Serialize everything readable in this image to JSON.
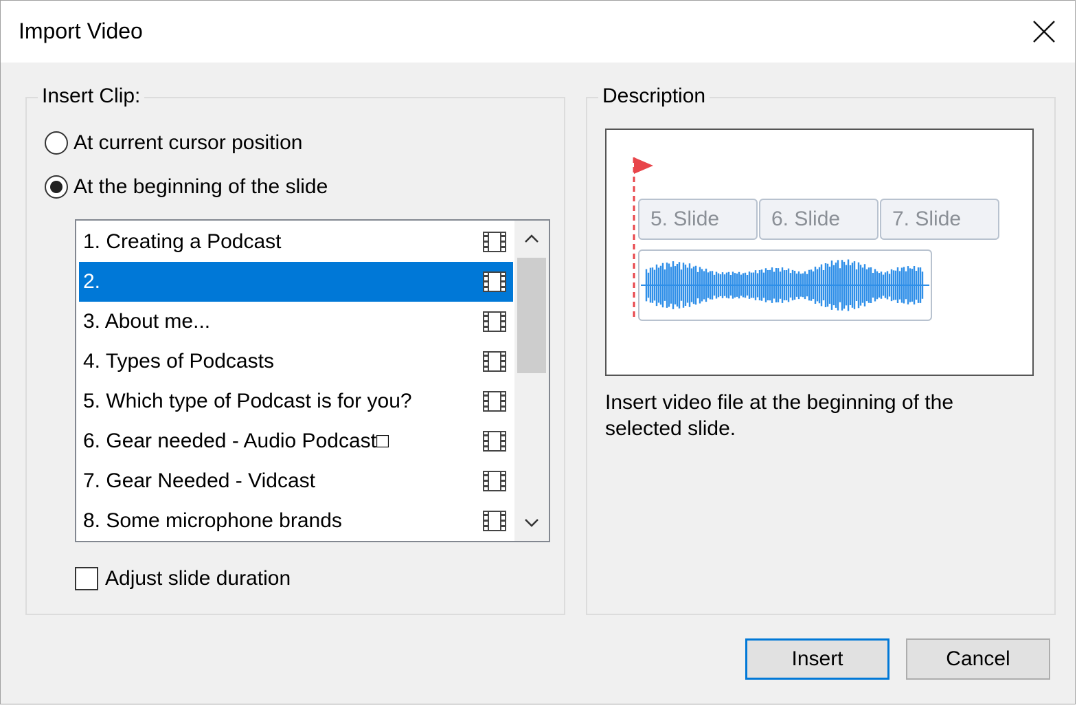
{
  "dialog": {
    "title": "Import Video",
    "close_icon": "close-icon"
  },
  "insert_clip": {
    "legend": "Insert Clip:",
    "options": [
      {
        "label": "At current cursor position",
        "selected": false
      },
      {
        "label": "At the beginning of the slide",
        "selected": true
      }
    ],
    "slides": [
      {
        "label": "1. Creating a Podcast",
        "selected": false
      },
      {
        "label": "2.",
        "selected": true
      },
      {
        "label": "3. About me...",
        "selected": false
      },
      {
        "label": "4. Types of Podcasts",
        "selected": false
      },
      {
        "label": "5. Which type of Podcast is for you?",
        "selected": false
      },
      {
        "label": "6. Gear needed - Audio Podcast□",
        "selected": false
      },
      {
        "label": "7. Gear Needed - Vidcast",
        "selected": false
      },
      {
        "label": "8. Some microphone brands",
        "selected": false
      }
    ],
    "row_icon": "film-strip-icon",
    "adjust_duration": {
      "label": "Adjust slide duration",
      "checked": false
    }
  },
  "description": {
    "legend": "Description",
    "preview_slides": [
      "5. Slide",
      "6. Slide",
      "7. Slide"
    ],
    "marker_color": "#e8454a",
    "waveform_color": "#2f8fe8",
    "text": "Insert video file at the beginning of the selected slide."
  },
  "buttons": {
    "insert": "Insert",
    "cancel": "Cancel"
  },
  "colors": {
    "selection": "#0078d7",
    "dialog_bg": "#f0f0f0"
  }
}
